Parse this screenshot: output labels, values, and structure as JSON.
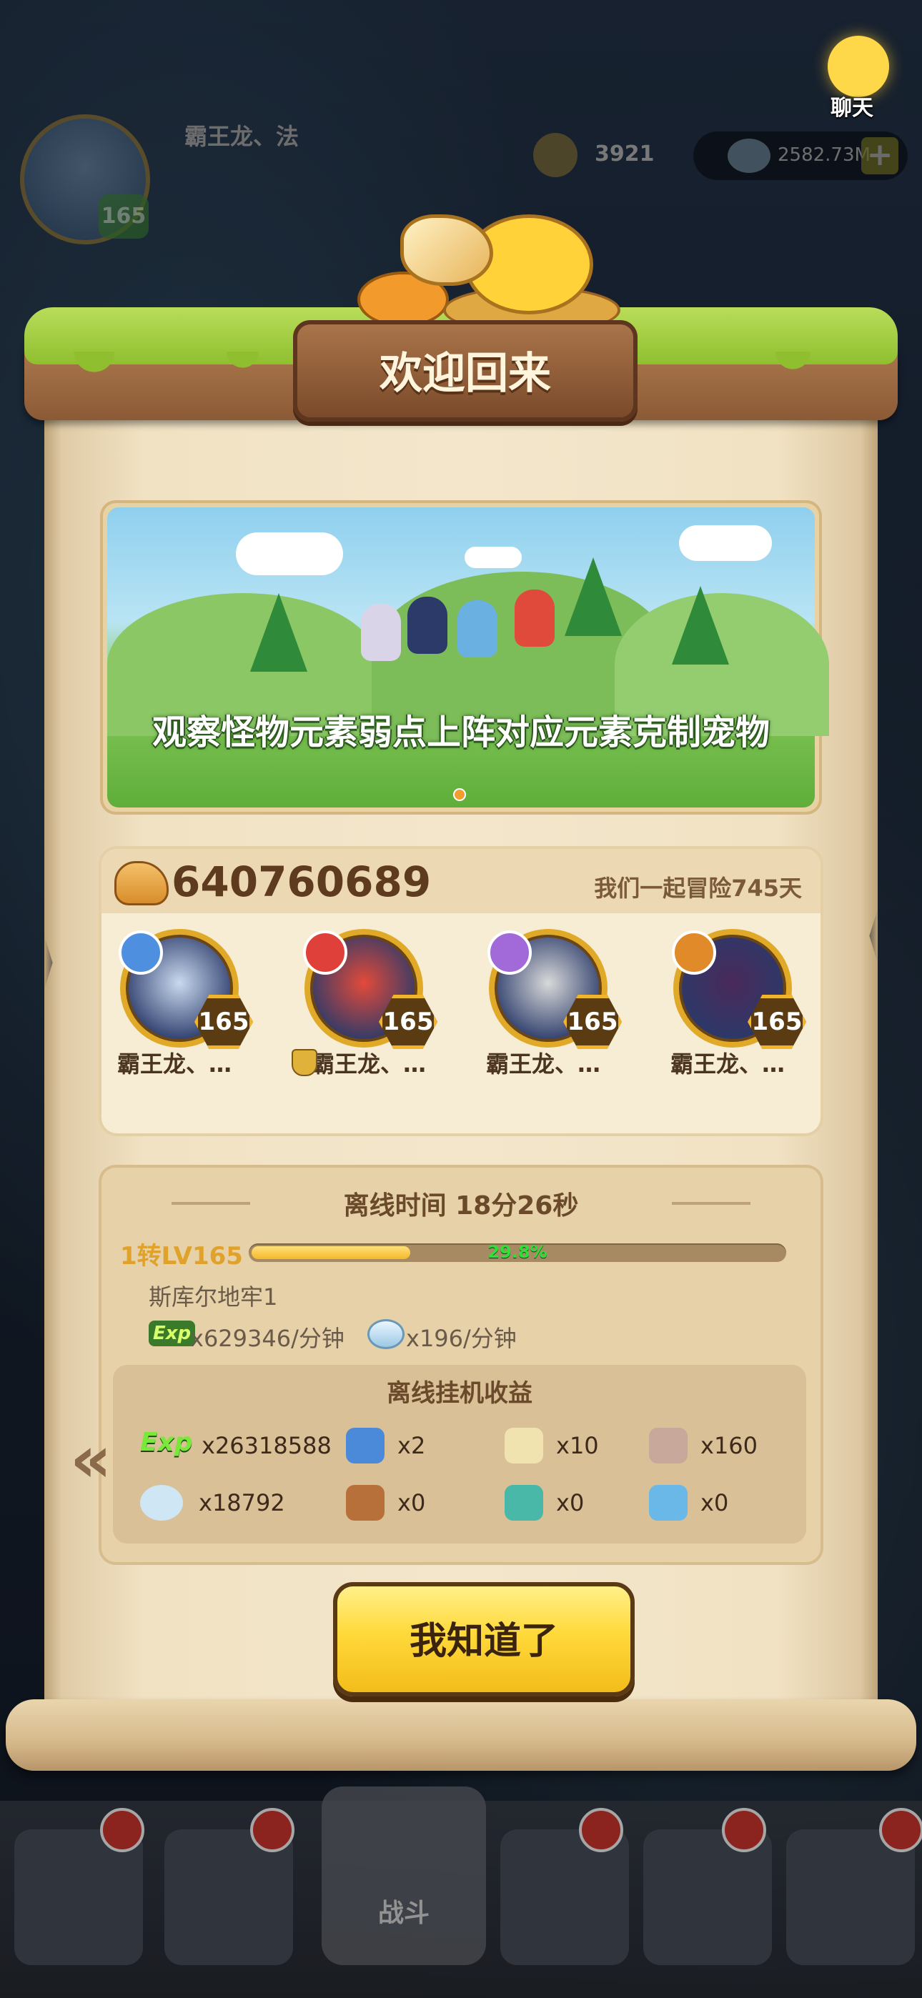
{
  "hud": {
    "player_name": "霸王龙、法",
    "player_level": "165",
    "gold": "3921",
    "gems": "2582.73M",
    "plus": "+",
    "chat_label": "聊天"
  },
  "popup": {
    "title": "欢迎回来",
    "banner_caption": "观察怪物元素弱点上阵对应元素克制宠物",
    "power": "640760689",
    "days_text": "我们一起冒险745天",
    "pets": [
      {
        "name": "霸王龙、…",
        "level": "165",
        "element": "wind",
        "color": "#4f8fe0"
      },
      {
        "name": "霸王龙、…",
        "level": "165",
        "element": "fire",
        "color": "#e0403a"
      },
      {
        "name": "霸王龙、…",
        "level": "165",
        "element": "dark",
        "color": "#a26ad8"
      },
      {
        "name": "霸王龙、…",
        "level": "165",
        "element": "water",
        "color": "#e08a2a"
      }
    ],
    "offline_time": "离线时间 18分26秒",
    "rebirth_level": "1转LV165",
    "xp_percent": "29.8%",
    "xp_fraction": 0.298,
    "dungeon": "斯库尔地牢1",
    "exp_badge": "Exp",
    "exp_rate": "x629346/分钟",
    "gem_rate": "x196/分钟",
    "earnings_title": "离线挂机收益",
    "earnings": [
      {
        "icon": "exp-icon",
        "count": "x26318588"
      },
      {
        "icon": "blue-ticket-icon",
        "count": "x2"
      },
      {
        "icon": "candle-icon",
        "count": "x10"
      },
      {
        "icon": "medal-icon",
        "count": "x160"
      },
      {
        "icon": "gem-icon",
        "count": "x18792"
      },
      {
        "icon": "meat-icon",
        "count": "x0"
      },
      {
        "icon": "green-crystal-icon",
        "count": "x0"
      },
      {
        "icon": "ice-crystal-icon",
        "count": "x0"
      }
    ],
    "ok_button": "我知道了",
    "chevron": "«"
  },
  "bottom_nav": {
    "battle_label": "战斗"
  },
  "colors": {
    "accent_gold": "#f4b82a",
    "xp_text_green": "#2de03a",
    "parchment": "#f3e6cb"
  }
}
